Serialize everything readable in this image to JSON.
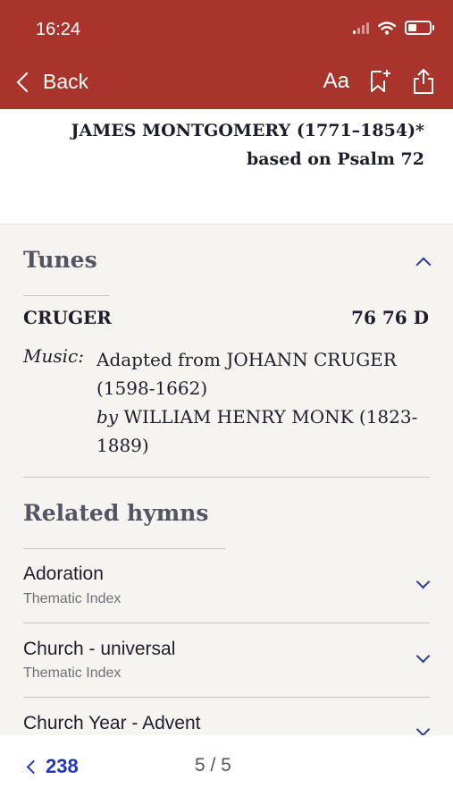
{
  "status": {
    "time": "16:24"
  },
  "nav": {
    "back_label": "Back",
    "text_size_label": "Aa"
  },
  "author": {
    "line1": "JAMES MONTGOMERY (1771–1854)*",
    "line2": "based on Psalm 72"
  },
  "tunes": {
    "title": "Tunes",
    "tune_name": "CRUGER",
    "meter": "76 76 D",
    "music_label": "Music:",
    "music_line1": "Adapted from JOHANN CRUGER",
    "music_line2": "(1598-1662)",
    "by_label": "by",
    "music_line3": "WILLIAM HENRY MONK (1823-",
    "music_line4": "1889)"
  },
  "related": {
    "title": "Related hymns",
    "items": [
      {
        "title": "Adoration",
        "subtitle": "Thematic Index"
      },
      {
        "title": "Church - universal",
        "subtitle": "Thematic Index"
      },
      {
        "title": "Church Year - Advent",
        "subtitle": ""
      }
    ]
  },
  "footer": {
    "prev_number": "238",
    "pager": "5 / 5"
  }
}
